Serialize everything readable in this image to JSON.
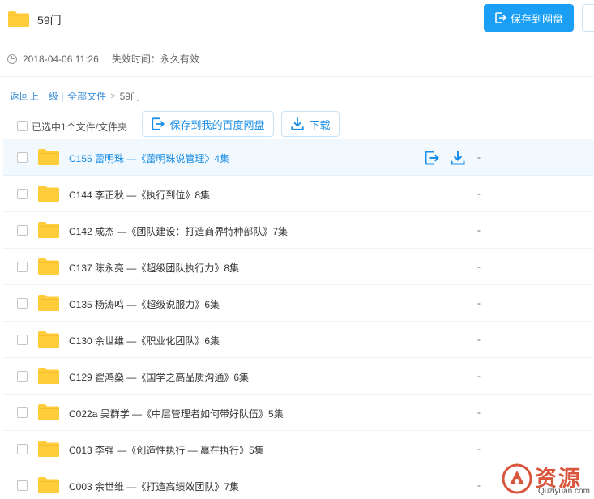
{
  "header": {
    "title": "59门",
    "save_button": "保存到网盘"
  },
  "meta": {
    "created": "2018-04-06 11:26",
    "expire": "失效时间：永久有效"
  },
  "breadcrumb": {
    "back": "返回上一级",
    "all_files": "全部文件",
    "current": "59门"
  },
  "toolbar": {
    "selected": "已选中1个文件/文件夹",
    "save_label": "保存到我的百度网盘",
    "download_label": "下载"
  },
  "colors": {
    "accent": "#1a9ff5",
    "folder": "#ffcd3a",
    "highlight_row": "#f1f8fe",
    "watermark": "#d9563c"
  },
  "files": [
    {
      "name": "C155 蕾明珠 —《蕾明珠说管理》4集",
      "size": "-",
      "selected": true
    },
    {
      "name": "C144 李正秋 —《执行到位》8集",
      "size": "-"
    },
    {
      "name": "C142 成杰 —《团队建设：打造商界特种部队》7集",
      "size": "-"
    },
    {
      "name": "C137 陈永亮 —《超级团队执行力》8集",
      "size": "-"
    },
    {
      "name": "C135 杨涛鸣 —《超级说服力》6集",
      "size": "-"
    },
    {
      "name": "C130 余世维 —《职业化团队》6集",
      "size": "-"
    },
    {
      "name": "C129 翟鸿燊 —《国学之高品质沟通》6集",
      "size": "-"
    },
    {
      "name": "C022a 吴群学 —《中层管理者如何带好队伍》5集",
      "size": "-"
    },
    {
      "name": "C013 李强 —《创造性执行 — 赢在执行》5集",
      "size": "-"
    },
    {
      "name": "C003 余世维 —《打造高绩效团队》7集",
      "size": "-"
    }
  ],
  "watermark": {
    "text": "资源",
    "url": "Quziyuan.com"
  }
}
